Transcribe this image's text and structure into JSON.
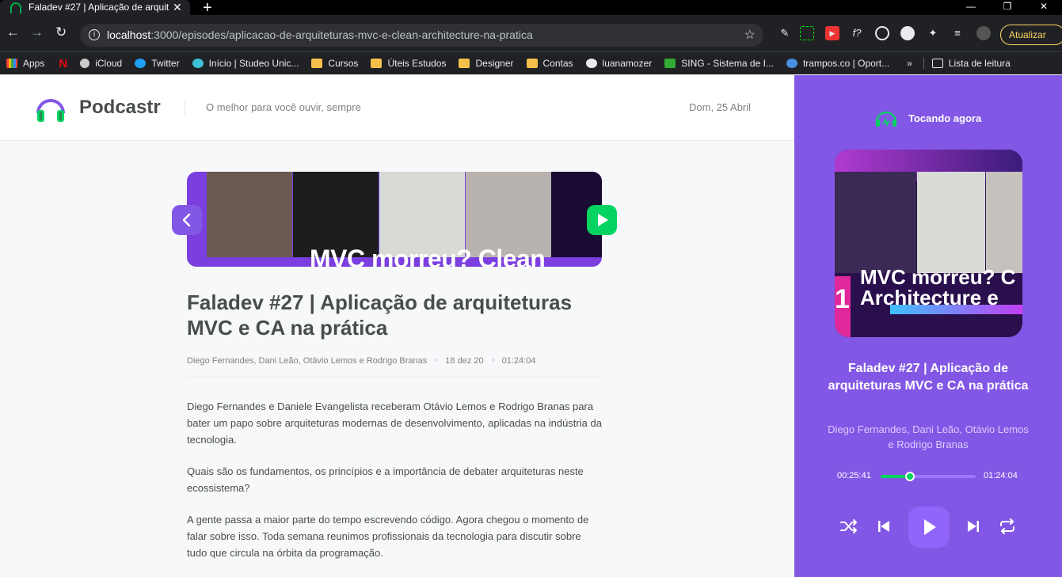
{
  "browser": {
    "tab_title": "Faladev #27 | Aplicação de arquit",
    "tab_close": "✕",
    "new_tab": "+",
    "url_host": "localhost",
    "url_path": ":3000/episodes/aplicacao-de-arquiteturas-mvc-e-clean-architecture-na-pratica",
    "update_label": "Atualizar",
    "bookmarks": [
      "Apps",
      "iCloud",
      "Twitter",
      "Início | Studeo Unic...",
      "Cursos",
      "Úteis Estudos",
      "Designer",
      "Contas",
      "luanamozer",
      "SING - Sistema de I...",
      "trampos.co | Oport...",
      "»",
      "Lista de leitura"
    ]
  },
  "header": {
    "brand": "Podcastr",
    "tagline": "O melhor para você ouvir, sempre",
    "date": "Dom, 25 Abril"
  },
  "episode": {
    "thumbnail_text": "MVC morreu? Clean",
    "title": "Faladev #27 | Aplicação de arquiteturas MVC e CA na prática",
    "members": "Diego Fernandes, Dani Leão, Otávio Lemos e Rodrigo Branas",
    "published": "18 dez 20",
    "duration": "01:24:04",
    "description": [
      "Diego Fernandes e Daniele Evangelista receberam Otávio Lemos e Rodrigo Branas para bater um papo sobre arquiteturas modernas de desenvolvimento, aplicadas na indústria da tecnologia.",
      "Quais são os fundamentos, os princípios e a importância de debater arquiteturas neste ecossistema?",
      "A gente passa a maior parte do tempo escrevendo código. Agora chegou o momento de falar sobre isso. Toda semana reunimos profissionais da tecnologia para discutir sobre tudo que circula na órbita da programação."
    ]
  },
  "player": {
    "label": "Tocando agora",
    "cover_text": "MVC morreu? C\nArchitecture e",
    "cover_side_number": "1",
    "title": "Faladev #27 | Aplicação de arquiteturas MVC e CA na prática",
    "members": "Diego Fernandes, Dani Leão, Otávio Lemos e Rodrigo Branas",
    "current_time": "00:25:41",
    "total_time": "01:24:04",
    "progress": 0.31
  },
  "colors": {
    "purple": "#8257e5",
    "green": "#04d361",
    "text": "#494d4b"
  }
}
